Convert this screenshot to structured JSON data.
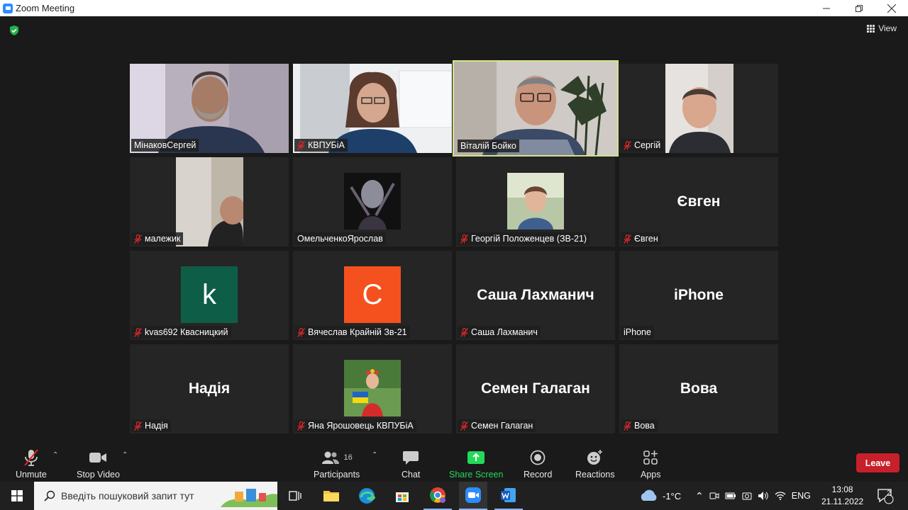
{
  "window": {
    "title": "Zoom Meeting"
  },
  "view_label": "View",
  "participants": [
    {
      "name": "МінаковСергей",
      "muted": false,
      "type": "video"
    },
    {
      "name": "КВПУБіА",
      "muted": true,
      "type": "video"
    },
    {
      "name": "Віталій Бойко",
      "muted": false,
      "type": "video",
      "active": true
    },
    {
      "name": "Сергій",
      "muted": true,
      "type": "video"
    },
    {
      "name": "малежик",
      "muted": true,
      "type": "video"
    },
    {
      "name": "ОмельченкоЯрослав",
      "muted": false,
      "type": "picture"
    },
    {
      "name": "Георгій Положенцев (ЗВ-21)",
      "muted": true,
      "type": "picture"
    },
    {
      "name": "Євген",
      "muted": true,
      "type": "name",
      "display": "Євген"
    },
    {
      "name": "kvas692 Квасницкий",
      "muted": true,
      "type": "avatar",
      "letter": "k",
      "color": "#0e5e47"
    },
    {
      "name": "Вячеслав Крайній Зв-21",
      "muted": true,
      "type": "avatar",
      "letter": "C",
      "color": "#f4511e"
    },
    {
      "name": "Саша Лахманич",
      "muted": true,
      "type": "name",
      "display": "Саша Лахманич"
    },
    {
      "name": "iPhone",
      "muted": false,
      "type": "name",
      "display": "iPhone"
    },
    {
      "name": "Надія",
      "muted": true,
      "type": "name",
      "display": "Надія"
    },
    {
      "name": "Яна Ярошовець КВПУБіА",
      "muted": true,
      "type": "picture"
    },
    {
      "name": "Семен Галаган",
      "muted": true,
      "type": "name",
      "display": "Семен Галаган"
    },
    {
      "name": "Вова",
      "muted": true,
      "type": "name",
      "display": "Вова"
    }
  ],
  "toolbar": {
    "unmute": "Unmute",
    "stop_video": "Stop Video",
    "participants": "Participants",
    "participants_count": "16",
    "chat": "Chat",
    "share_screen": "Share Screen",
    "record": "Record",
    "reactions": "Reactions",
    "apps": "Apps",
    "leave": "Leave"
  },
  "taskbar": {
    "search_placeholder": "Введіть пошуковий запит тут",
    "temperature": "-1°C",
    "language": "ENG",
    "time": "13:08",
    "date": "21.11.2022",
    "notifications": "2"
  },
  "colors": {
    "active_speaker": "#d4e28a",
    "leave": "#c8202a",
    "share": "#23d959",
    "muted": "#e02828",
    "shield": "#23b24b"
  }
}
